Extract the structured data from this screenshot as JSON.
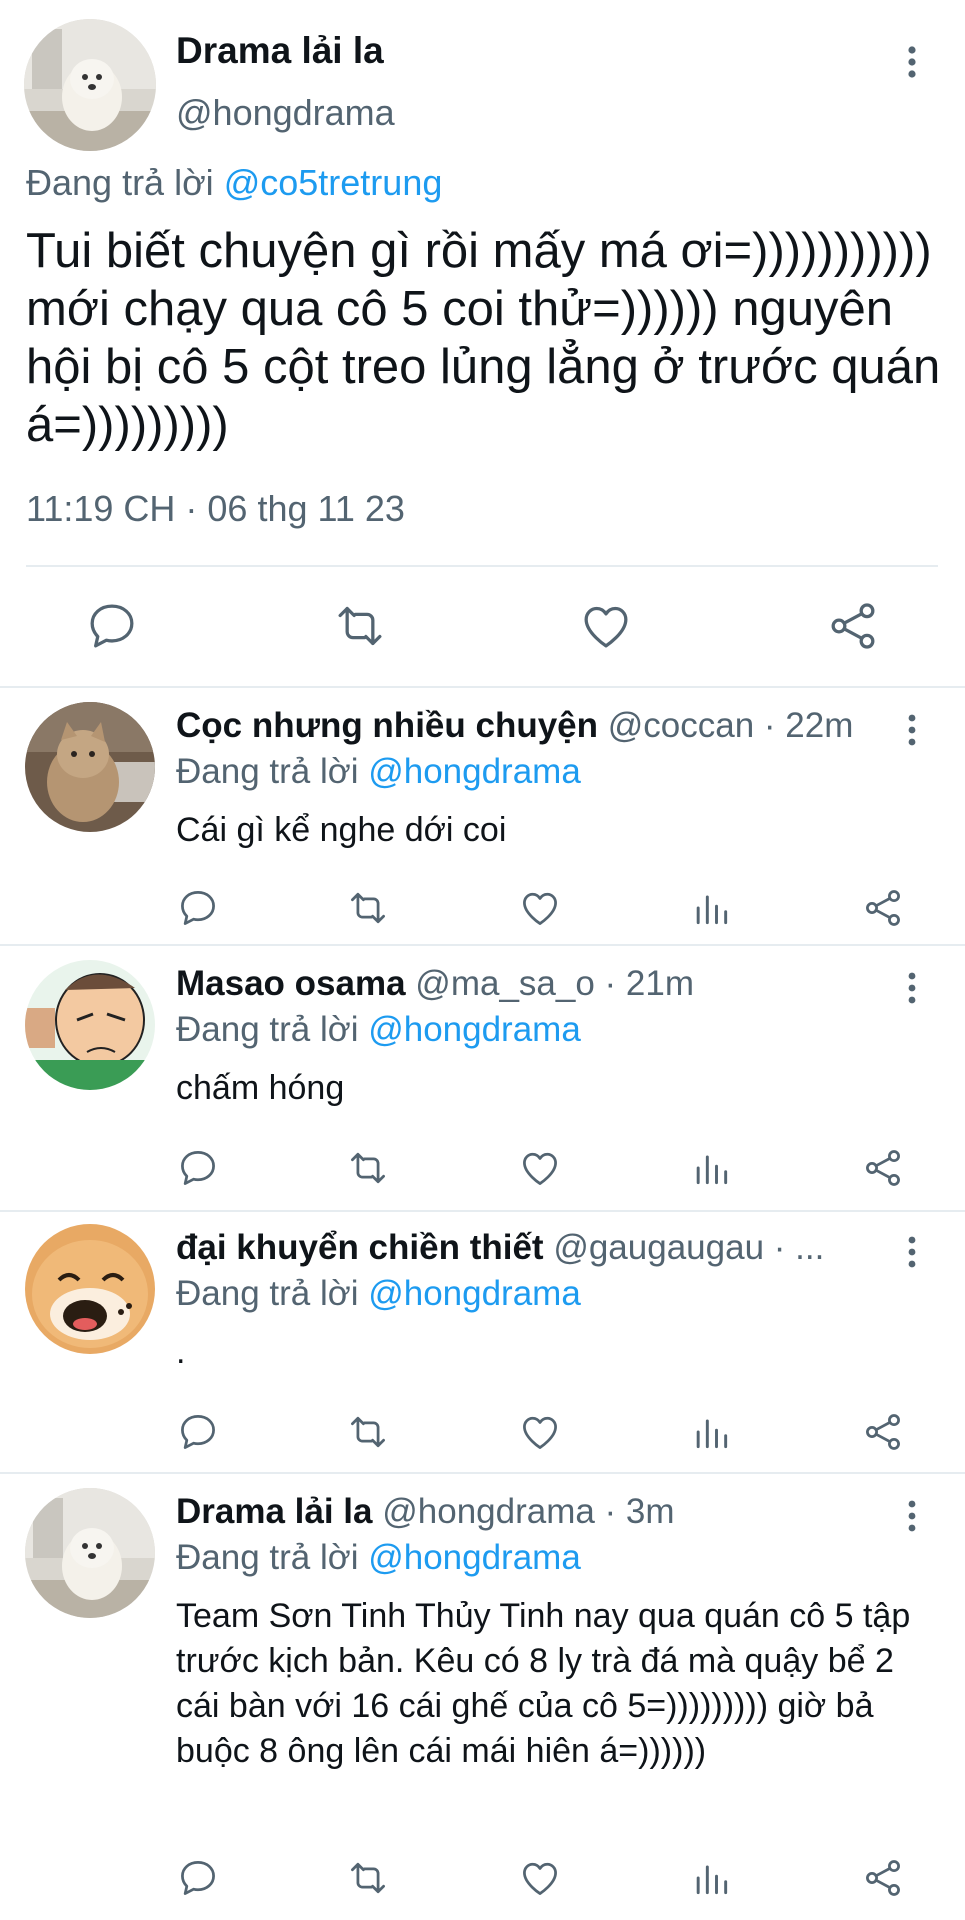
{
  "main_tweet": {
    "author_name": "Drama lải la",
    "handle": "@hongdrama",
    "replying_prefix": "Đang trả lời",
    "replying_to": "@co5tretrung",
    "text": "Tui biết chuyện gì rồi mấy má ơi=))))))))))) mới chạy qua cô 5 coi thử=)))))) nguyên hội bị cô 5 cột treo lủng lẳng ở trước quán á=)))))))))",
    "timestamp": "11:19 CH · 06 thg 11 23"
  },
  "replies": [
    {
      "name": "Cọc nhưng nhiều chuyện",
      "meta": "@coccan · 22m",
      "replying_prefix": "Đang trả lời",
      "replying_to": "@hongdrama",
      "text": "Cái gì kể nghe dới coi"
    },
    {
      "name": "Masao osama",
      "meta": "@ma_sa_o · 21m",
      "replying_prefix": "Đang trả lời",
      "replying_to": "@hongdrama",
      "text": "chấm hóng"
    },
    {
      "name": "đại khuyển chiền thiết",
      "meta": "@gaugaugau · ...",
      "replying_prefix": "Đang trả lời",
      "replying_to": "@hongdrama",
      "text": "."
    },
    {
      "name": "Drama lải la",
      "meta": "@hongdrama · 3m",
      "replying_prefix": "Đang trả lời",
      "replying_to": "@hongdrama",
      "text": "Team Sơn Tinh Thủy Tinh nay qua quán cô 5 tập trước kịch bản. Kêu có 8 ly trà đá mà quậy bể 2 cái bàn với 16 cái ghế của cô 5=))))))))) giờ bả buộc 8 ông lên cái mái hiên á=))))))"
    }
  ],
  "icons": {
    "reply": "speech-bubble-icon",
    "retweet": "retweet-icon",
    "like": "heart-icon",
    "analytics": "bar-chart-icon",
    "share": "share-icon",
    "more": "vertical-ellipsis-icon"
  },
  "colors": {
    "text": "#0f1419",
    "secondary": "#536471",
    "link": "#1d9bf0",
    "divider": "#e6ecf0"
  }
}
